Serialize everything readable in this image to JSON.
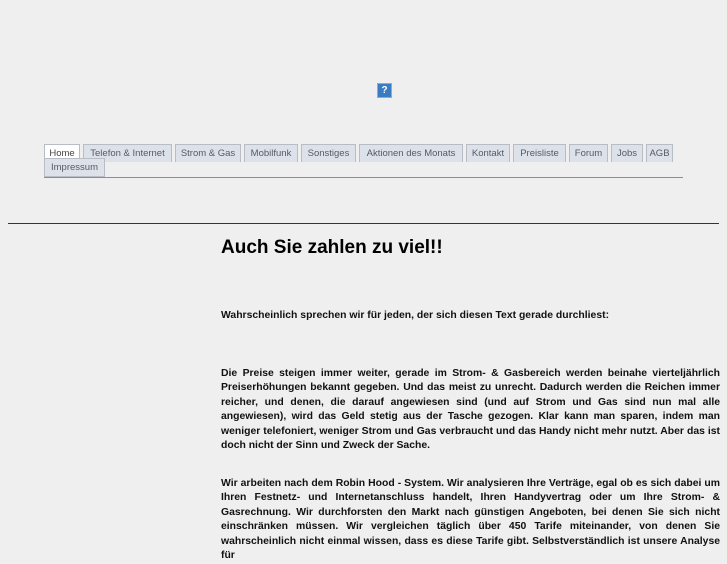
{
  "header": {
    "image_placeholder_icon": "question-mark-icon",
    "icon_glyph": "?"
  },
  "nav": {
    "tabs": [
      {
        "label": "Home",
        "active": true
      },
      {
        "label": "Telefon & Internet"
      },
      {
        "label": "Strom & Gas"
      },
      {
        "label": "Mobilfunk"
      },
      {
        "label": "Sonstiges"
      },
      {
        "label": "Aktionen des Monats"
      },
      {
        "label": "Kontakt"
      },
      {
        "label": "Preisliste"
      },
      {
        "label": "Forum"
      },
      {
        "label": "Jobs"
      },
      {
        "label": "AGB"
      },
      {
        "label": "Impressum"
      }
    ]
  },
  "main": {
    "title": "Auch Sie zahlen zu viel!!",
    "paragraphs": [
      "Wahrscheinlich sprechen wir für jeden, der sich diesen Text gerade durchliest:",
      "Die Preise steigen immer weiter, gerade im Strom- & Gasbereich werden beinahe vierteljährlich Preiserhöhungen bekannt gegeben. Und das meist zu unrecht. Dadurch werden die Reichen immer reicher, und denen, die darauf angewiesen sind (und auf Strom und Gas sind nun mal alle angewiesen), wird das Geld stetig aus der Tasche gezogen. Klar kann man sparen, indem man weniger telefoniert, weniger Strom und Gas verbraucht und das Handy nicht mehr nutzt. Aber das ist doch nicht der Sinn und Zweck der Sache.",
      "Wir arbeiten nach dem Robin Hood - System. Wir analysieren Ihre Verträge, egal ob es sich dabei um Ihren Festnetz- und Internetanschluss handelt, Ihren Handyvertrag oder um Ihre Strom- & Gasrechnung. Wir durchforsten den Markt nach günstigen Angeboten, bei denen Sie sich nicht einschränken müssen. Wir vergleichen täglich über 450 Tarife miteinander, von denen Sie wahrscheinlich nicht einmal wissen, dass es diese Tarife gibt. Selbstverständlich ist unsere Analyse für"
    ]
  }
}
